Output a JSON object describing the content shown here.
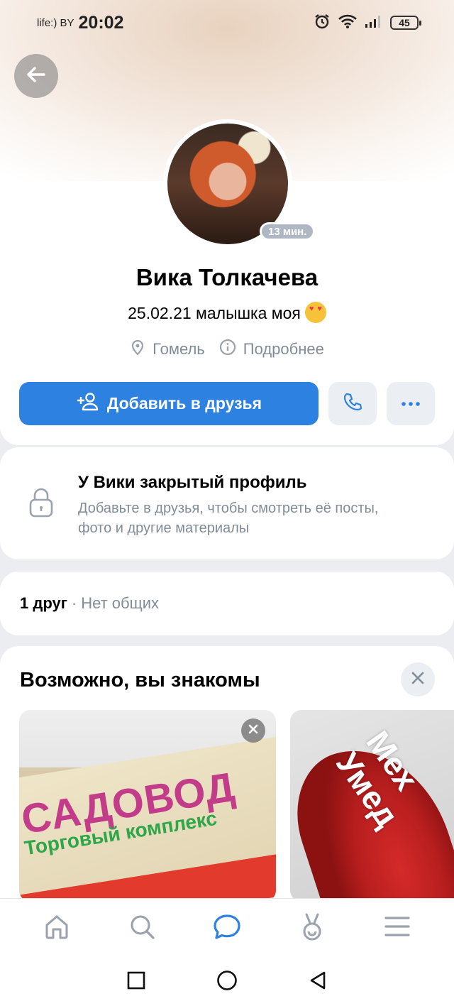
{
  "status_bar": {
    "carrier": "life:) BY",
    "time": "20:02",
    "battery": "45"
  },
  "profile": {
    "name": "Вика Толкачева",
    "status": "25.02.21 малышка моя",
    "online_badge": "13 мин.",
    "city": "Гомель",
    "details_link": "Подробнее",
    "add_friend_label": "Добавить в друзья"
  },
  "closed_profile": {
    "title": "У Вики закрытый профиль",
    "description": "Добавьте в друзья, чтобы смотреть её посты, фото и другие материалы"
  },
  "friends": {
    "count": "1 друг",
    "separator": "·",
    "common": "Нет общих"
  },
  "suggestions": {
    "title": "Возможно, вы знакомы",
    "tiles": [
      {
        "headline": "САДОВОД",
        "subline": "Торговый комплекс"
      },
      {
        "overlay_text": "Мех\nУмед"
      }
    ]
  },
  "colors": {
    "accent": "#2d81e0",
    "secondary_text": "#818c99",
    "button_bg": "#ebeef2"
  },
  "icons": {
    "back": "arrow-left-icon",
    "location": "location-pin-icon",
    "info": "info-icon",
    "add_user": "add-user-icon",
    "phone": "phone-icon",
    "more": "more-dots-icon",
    "lock": "lock-icon",
    "close": "close-icon",
    "nav": [
      "home-icon",
      "search-icon",
      "messages-icon",
      "clips-icon",
      "menu-icon"
    ],
    "system_nav": [
      "recents-icon",
      "home-circle-icon",
      "back-triangle-icon"
    ]
  }
}
